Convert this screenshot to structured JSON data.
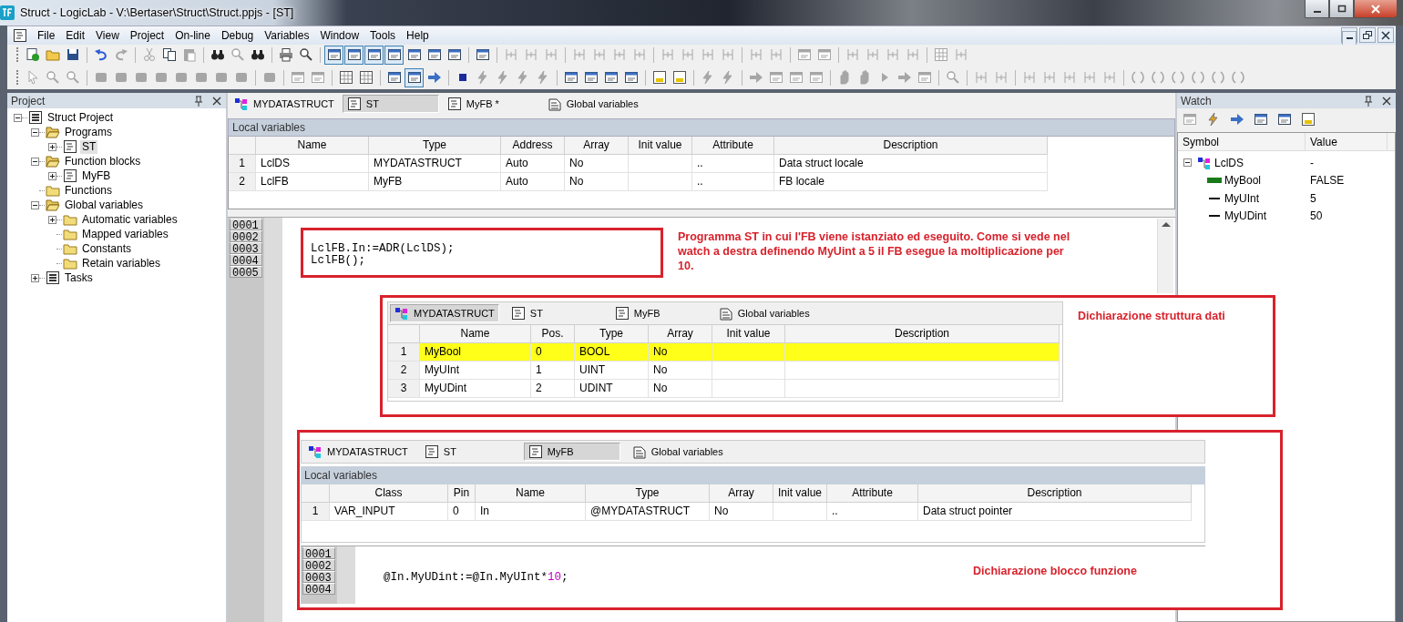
{
  "window": {
    "title": "Struct - LogicLab - V:\\Bertaser\\Struct\\Struct.ppjs - [ST]"
  },
  "menu": [
    {
      "label": "File"
    },
    {
      "label": "Edit"
    },
    {
      "label": "View"
    },
    {
      "label": "Project"
    },
    {
      "label": "On-line"
    },
    {
      "label": "Debug"
    },
    {
      "label": "Variables"
    },
    {
      "label": "Window"
    },
    {
      "label": "Tools"
    },
    {
      "label": "Help"
    }
  ],
  "toolbars": [
    {
      "buttons": [
        {
          "on": false,
          "disabled": false
        },
        {
          "on": false,
          "disabled": false
        },
        {
          "on": false,
          "disabled": false
        },
        {
          "on": false,
          "disabled": false
        },
        {
          "on": false,
          "disabled": true
        },
        {
          "on": false,
          "disabled": true
        },
        {
          "on": false,
          "disabled": false
        },
        {
          "on": false,
          "disabled": true
        },
        {
          "on": false,
          "disabled": false
        },
        {
          "on": false,
          "disabled": true
        },
        {
          "on": false,
          "disabled": false
        },
        {
          "on": false,
          "disabled": false
        },
        {
          "on": false,
          "disabled": false
        },
        {
          "on": true,
          "disabled": false
        },
        {
          "on": true,
          "disabled": false
        },
        {
          "on": true,
          "disabled": false
        },
        {
          "on": true,
          "disabled": false
        },
        {
          "on": false,
          "disabled": false
        },
        {
          "on": false,
          "disabled": false
        },
        {
          "on": false,
          "disabled": false
        },
        {
          "on": false,
          "disabled": false
        },
        {
          "on": false,
          "disabled": true
        },
        {
          "on": false,
          "disabled": true
        },
        {
          "on": false,
          "disabled": true
        },
        {
          "on": false,
          "disabled": true
        },
        {
          "on": false,
          "disabled": true
        },
        {
          "on": false,
          "disabled": true
        },
        {
          "on": false,
          "disabled": true
        },
        {
          "on": false,
          "disabled": true
        },
        {
          "on": false,
          "disabled": true
        },
        {
          "on": false,
          "disabled": true
        },
        {
          "on": false,
          "disabled": true
        },
        {
          "on": false,
          "disabled": true
        },
        {
          "on": false,
          "disabled": true
        },
        {
          "on": false,
          "disabled": true
        },
        {
          "on": false,
          "disabled": true
        },
        {
          "on": false,
          "disabled": true
        },
        {
          "on": false,
          "disabled": true
        },
        {
          "on": false,
          "disabled": true
        },
        {
          "on": false,
          "disabled": true
        },
        {
          "on": false,
          "disabled": true
        },
        {
          "on": false,
          "disabled": true
        }
      ]
    },
    {
      "buttons": [
        {
          "on": false,
          "disabled": true
        },
        {
          "on": false,
          "disabled": true
        },
        {
          "on": false,
          "disabled": true
        },
        {
          "on": false,
          "disabled": true
        },
        {
          "on": false,
          "disabled": true
        },
        {
          "on": false,
          "disabled": true
        },
        {
          "on": false,
          "disabled": true
        },
        {
          "on": false,
          "disabled": true
        },
        {
          "on": false,
          "disabled": true
        },
        {
          "on": false,
          "disabled": true
        },
        {
          "on": false,
          "disabled": true
        },
        {
          "on": false,
          "disabled": true
        },
        {
          "on": false,
          "disabled": true
        },
        {
          "on": false,
          "disabled": true
        },
        {
          "on": false,
          "disabled": false
        },
        {
          "on": false,
          "disabled": false
        },
        {
          "on": false,
          "disabled": false
        },
        {
          "on": true,
          "disabled": false
        },
        {
          "on": false,
          "disabled": false
        },
        {
          "on": false,
          "disabled": false
        },
        {
          "on": false,
          "disabled": true
        },
        {
          "on": false,
          "disabled": true
        },
        {
          "on": false,
          "disabled": true
        },
        {
          "on": false,
          "disabled": true
        },
        {
          "on": false,
          "disabled": false
        },
        {
          "on": false,
          "disabled": false
        },
        {
          "on": false,
          "disabled": false
        },
        {
          "on": false,
          "disabled": false
        },
        {
          "on": false,
          "disabled": false
        },
        {
          "on": false,
          "disabled": false
        },
        {
          "on": false,
          "disabled": true
        },
        {
          "on": false,
          "disabled": true
        },
        {
          "on": false,
          "disabled": true
        },
        {
          "on": false,
          "disabled": true
        },
        {
          "on": false,
          "disabled": true
        },
        {
          "on": false,
          "disabled": true
        },
        {
          "on": false,
          "disabled": true
        },
        {
          "on": false,
          "disabled": true
        },
        {
          "on": false,
          "disabled": true
        },
        {
          "on": false,
          "disabled": true
        },
        {
          "on": false,
          "disabled": true
        },
        {
          "on": false,
          "disabled": true
        },
        {
          "on": false,
          "disabled": true
        },
        {
          "on": false,
          "disabled": true
        },
        {
          "on": false,
          "disabled": true
        },
        {
          "on": false,
          "disabled": true
        },
        {
          "on": false,
          "disabled": true
        },
        {
          "on": false,
          "disabled": true
        },
        {
          "on": false,
          "disabled": true
        },
        {
          "on": false,
          "disabled": true
        },
        {
          "on": false,
          "disabled": true
        },
        {
          "on": false,
          "disabled": true
        },
        {
          "on": false,
          "disabled": true
        },
        {
          "on": false,
          "disabled": true
        },
        {
          "on": false,
          "disabled": true
        }
      ]
    }
  ],
  "project_panel": {
    "title": "Project",
    "tree": [
      {
        "label": "Struct Project",
        "kind": "project",
        "expanded": true,
        "selected": false,
        "children": [
          {
            "label": "Programs",
            "kind": "folder",
            "expanded": true,
            "selected": false,
            "children": [
              {
                "label": "ST",
                "kind": "pou",
                "expanded": false,
                "selected": true
              }
            ]
          },
          {
            "label": "Function blocks",
            "kind": "folder",
            "expanded": true,
            "selected": false,
            "children": [
              {
                "label": "MyFB",
                "kind": "pou",
                "expanded": false,
                "selected": false
              }
            ]
          },
          {
            "label": "Functions",
            "kind": "folder",
            "selected": false
          },
          {
            "label": "Global variables",
            "kind": "folder",
            "expanded": true,
            "selected": false,
            "children": [
              {
                "label": "Automatic variables",
                "kind": "folder",
                "expanded": false,
                "selected": false
              },
              {
                "label": "Mapped variables",
                "kind": "folder",
                "selected": false
              },
              {
                "label": "Constants",
                "kind": "folder",
                "selected": false
              },
              {
                "label": "Retain variables",
                "kind": "folder",
                "selected": false
              }
            ]
          },
          {
            "label": "Tasks",
            "kind": "project",
            "expanded": false,
            "selected": false
          }
        ]
      }
    ]
  },
  "editor": {
    "tabs": [
      {
        "label": "MYDATASTRUCT",
        "kind": "struct",
        "selected": false
      },
      {
        "label": "ST",
        "kind": "pou",
        "selected": true
      },
      {
        "label": "MyFB *",
        "kind": "pou",
        "selected": false
      },
      {
        "label": "Global variables",
        "kind": "globals",
        "selected": false
      }
    ],
    "section_title": "Local variables",
    "columns": [
      "",
      "Name",
      "Type",
      "Address",
      "Array",
      "Init value",
      "Attribute",
      "Description"
    ],
    "rows": [
      {
        "cells": [
          "1",
          "LclDS",
          "MYDATASTRUCT",
          "Auto",
          "No",
          null,
          "..",
          "Data struct locale"
        ]
      },
      {
        "cells": [
          "2",
          "LclFB",
          "MyFB",
          "Auto",
          "No",
          null,
          "..",
          "FB locale"
        ]
      }
    ],
    "code": [
      {
        "number": "0001"
      },
      {
        "number": "0002"
      },
      {
        "number": "0003",
        "tokens": [
          {
            "text": "LclFB.In:=ADR(LclDS);",
            "kind": "plain"
          }
        ]
      },
      {
        "number": "0004",
        "tokens": [
          {
            "text": "LclFB();",
            "kind": "plain"
          }
        ]
      },
      {
        "number": "0005"
      }
    ]
  },
  "insets": [
    {
      "tabs": [
        {
          "label": "MYDATASTRUCT",
          "kind": "struct",
          "selected": true
        },
        {
          "label": "ST",
          "kind": "pou",
          "selected": false
        },
        {
          "label": "MyFB",
          "kind": "pou",
          "selected": false
        },
        {
          "label": "Global variables",
          "kind": "globals",
          "selected": false
        }
      ],
      "columns": [
        "",
        "Name",
        "Pos.",
        "Type",
        "Array",
        "Init value",
        "Description"
      ],
      "rows": [
        {
          "cells": [
            "1",
            "MyBool",
            "0",
            "BOOL",
            "No",
            null,
            null
          ],
          "selected": true
        },
        {
          "cells": [
            "2",
            "MyUInt",
            "1",
            "UINT",
            "No",
            null,
            null
          ],
          "selected": false
        },
        {
          "cells": [
            "3",
            "MyUDint",
            "2",
            "UDINT",
            "No",
            null,
            null
          ],
          "selected": false
        }
      ]
    },
    {
      "tabs": [
        {
          "label": "MYDATASTRUCT",
          "kind": "struct",
          "selected": false
        },
        {
          "label": "ST",
          "kind": "pou",
          "selected": false
        },
        {
          "label": "MyFB",
          "kind": "pou",
          "selected": true
        },
        {
          "label": "Global variables",
          "kind": "globals",
          "selected": false
        }
      ],
      "section_title": "Local variables",
      "columns": [
        "",
        "Class",
        "Pin",
        "Name",
        "Type",
        "Array",
        "Init value",
        "Attribute",
        "Description"
      ],
      "rows": [
        {
          "cells": [
            "1",
            "VAR_INPUT",
            "0",
            "In",
            "@MYDATASTRUCT",
            "No",
            null,
            "..",
            "Data struct pointer"
          ]
        }
      ],
      "code": [
        {
          "number": "0001"
        },
        {
          "number": "0002"
        },
        {
          "number": "0003",
          "tokens": [
            {
              "text": "@In.MyUDint:=@In.MyUInt*",
              "kind": "plain"
            },
            {
              "text": "10",
              "kind": "number"
            },
            {
              "text": ";",
              "kind": "plain"
            }
          ]
        },
        {
          "number": "0004"
        }
      ]
    }
  ],
  "notes": [
    {
      "text": "Programma ST in cui l'FB viene istanziato ed eseguito. Come si vede nel watch a destra definendo MyUint a 5 il FB esegue la moltiplicazione per 10."
    },
    {
      "text": "Dichiarazione struttura dati"
    },
    {
      "text": "Dichiarazione blocco funzione"
    }
  ],
  "watch_panel": {
    "title": "Watch",
    "toolbar": [
      {
        "disabled": true
      },
      {
        "disabled": false
      },
      {
        "disabled": false
      },
      {
        "disabled": false
      },
      {
        "disabled": false
      },
      {
        "disabled": false
      }
    ],
    "columns": [
      "Symbol",
      "Value"
    ],
    "tree": [
      {
        "symbol": "LclDS",
        "value": "-",
        "kind": "struct",
        "expanded": true,
        "children": [
          {
            "symbol": "MyBool",
            "value": "FALSE",
            "kind": "bool"
          },
          {
            "symbol": "MyUInt",
            "value": "5",
            "kind": "number"
          },
          {
            "symbol": "MyUDint",
            "value": "50",
            "kind": "number"
          }
        ]
      }
    ]
  }
}
